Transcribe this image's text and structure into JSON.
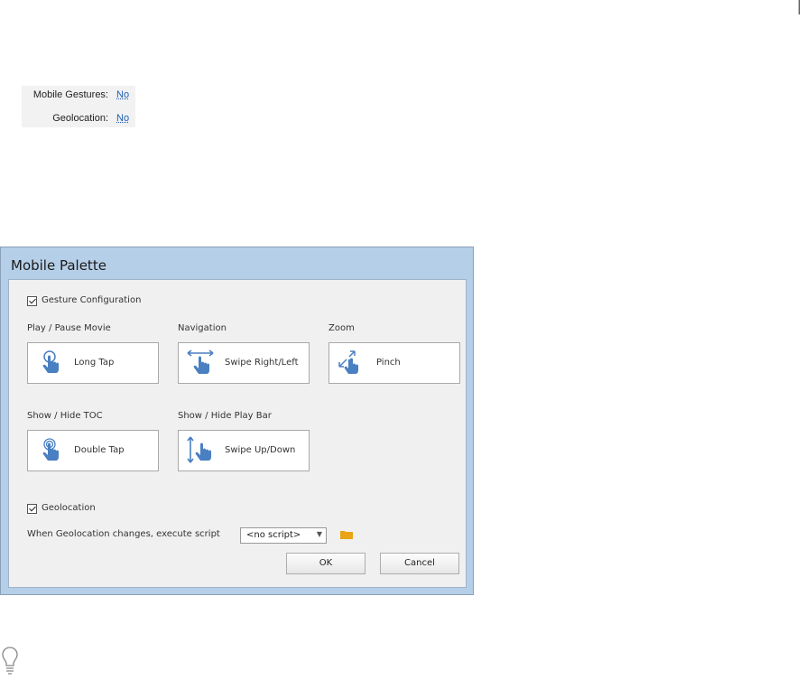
{
  "properties": {
    "mobile_gestures": {
      "label": "Mobile Gestures:",
      "value": "No"
    },
    "geolocation": {
      "label": "Geolocation:",
      "value": "No"
    }
  },
  "dialog": {
    "title": "Mobile Palette",
    "gesture_configuration": {
      "label": "Gesture Configuration",
      "checked": true
    },
    "gestures": [
      {
        "heading": "Play / Pause Movie",
        "button": "Long Tap",
        "icon": "long-tap-icon"
      },
      {
        "heading": "Navigation",
        "button": "Swipe Right/Left",
        "icon": "swipe-horizontal-icon"
      },
      {
        "heading": "Zoom",
        "button": "Pinch",
        "icon": "pinch-icon"
      },
      {
        "heading": "Show / Hide TOC",
        "button": "Double Tap",
        "icon": "double-tap-icon"
      },
      {
        "heading": "Show / Hide Play Bar",
        "button": "Swipe Up/Down",
        "icon": "swipe-vertical-icon"
      }
    ],
    "geolocation": {
      "label": "Geolocation",
      "checked": true
    },
    "script_row": {
      "label": "When Geolocation changes, execute script",
      "selected": "<no script>"
    },
    "ok_label": "OK",
    "cancel_label": "Cancel"
  },
  "colors": {
    "link": "#1f5fb3",
    "title_bar": "#b6cfe8",
    "folder": "#e8a317",
    "hand_blue": "#4a7fc1"
  }
}
